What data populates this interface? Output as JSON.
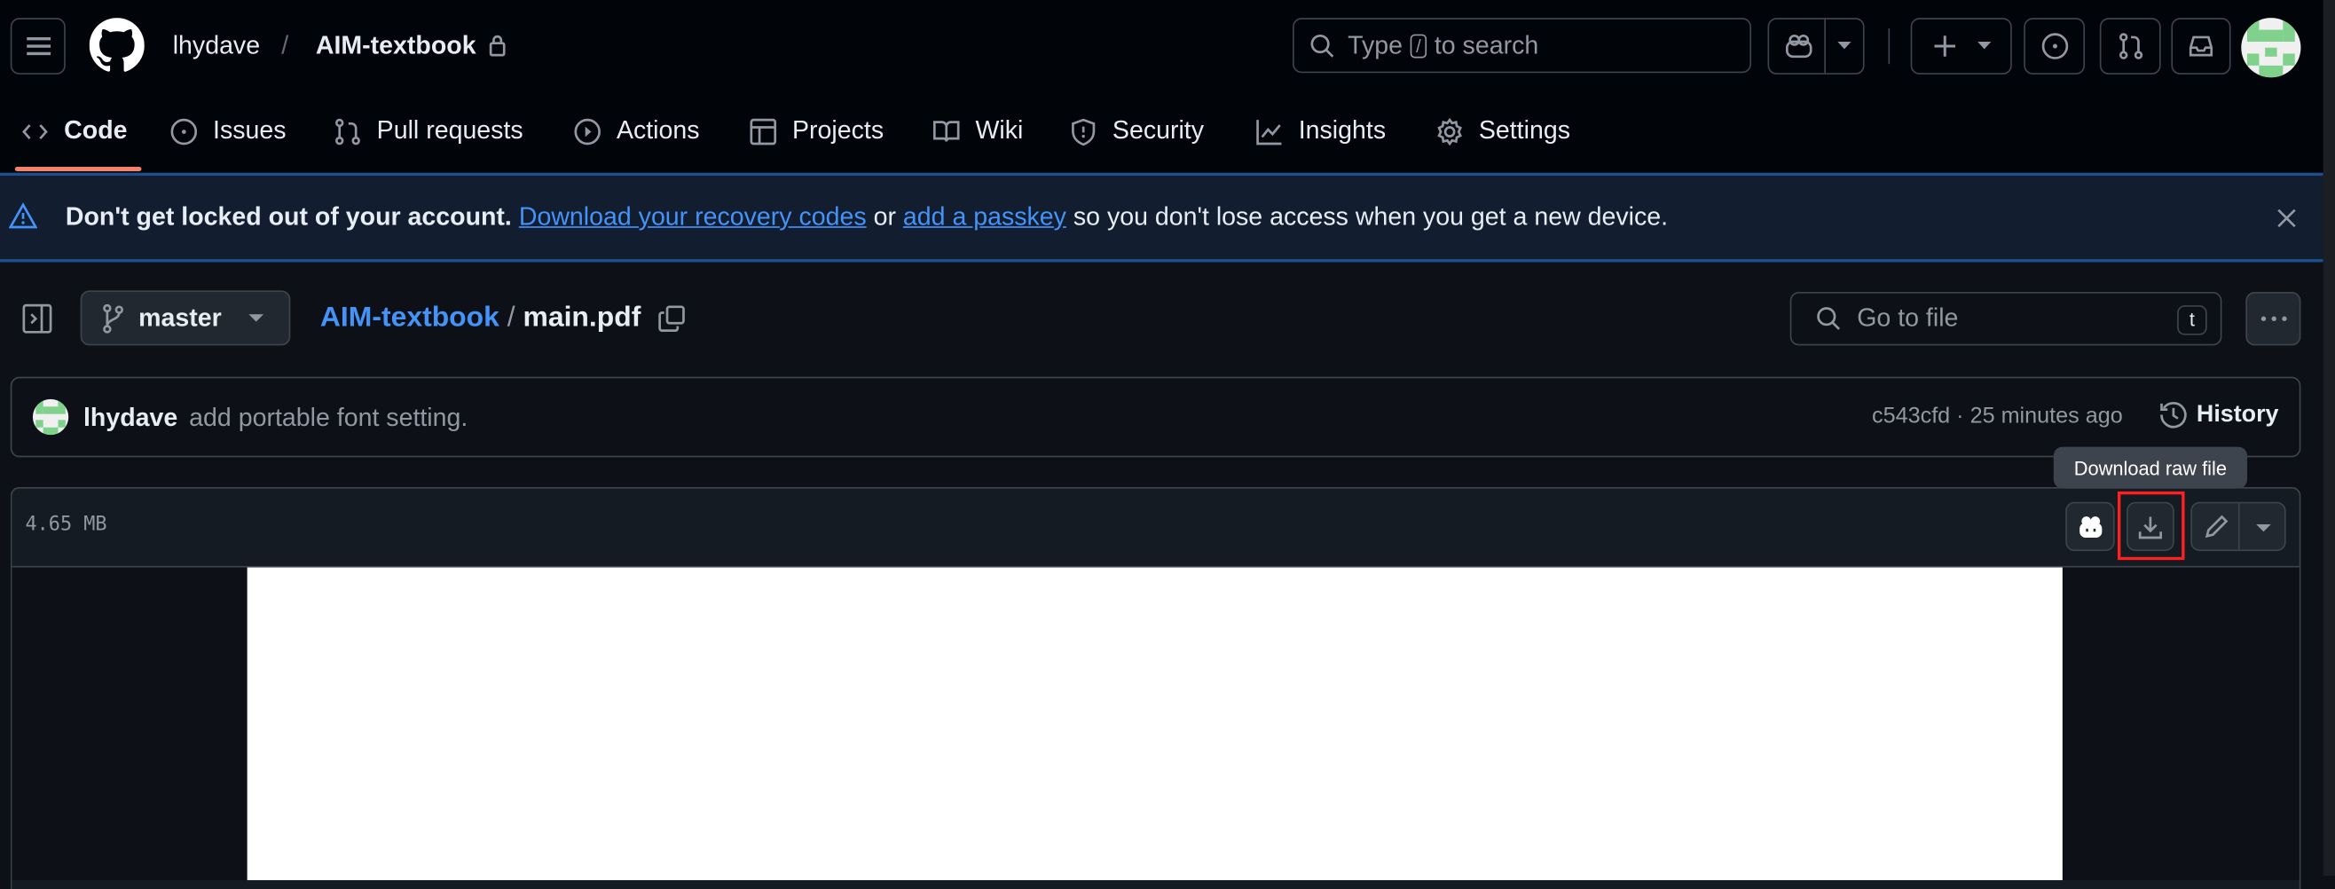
{
  "header": {
    "owner": "lhydave",
    "separator": "/",
    "repo": "AIM-textbook",
    "search_prefix": "Type",
    "search_key": "/",
    "search_suffix": "to search"
  },
  "tabs": [
    {
      "label": "Code",
      "icon": "code-icon",
      "active": true
    },
    {
      "label": "Issues",
      "icon": "issue-icon"
    },
    {
      "label": "Pull requests",
      "icon": "pull-request-icon"
    },
    {
      "label": "Actions",
      "icon": "play-icon"
    },
    {
      "label": "Projects",
      "icon": "table-icon"
    },
    {
      "label": "Wiki",
      "icon": "book-icon"
    },
    {
      "label": "Security",
      "icon": "shield-icon"
    },
    {
      "label": "Insights",
      "icon": "graph-icon"
    },
    {
      "label": "Settings",
      "icon": "gear-icon"
    }
  ],
  "banner": {
    "bold": "Don't get locked out of your account.",
    "link1": "Download your recovery codes",
    "mid": "or",
    "link2": "add a passkey",
    "tail": "so you don't lose access when you get a new device."
  },
  "file": {
    "branch": "master",
    "repo_link": "AIM-textbook",
    "sep": "/",
    "filename": "main.pdf",
    "goto_placeholder": "Go to file",
    "goto_key": "t"
  },
  "commit": {
    "author": "lhydave",
    "message": "add portable font setting.",
    "sha_time": "c543cfd · 25 minutes ago",
    "history": "History"
  },
  "viewer": {
    "size": "4.65 MB",
    "tooltip": "Download raw file"
  },
  "colors": {
    "accent": "#f78166",
    "link": "#4493f8",
    "highlight": "#ff2020"
  }
}
